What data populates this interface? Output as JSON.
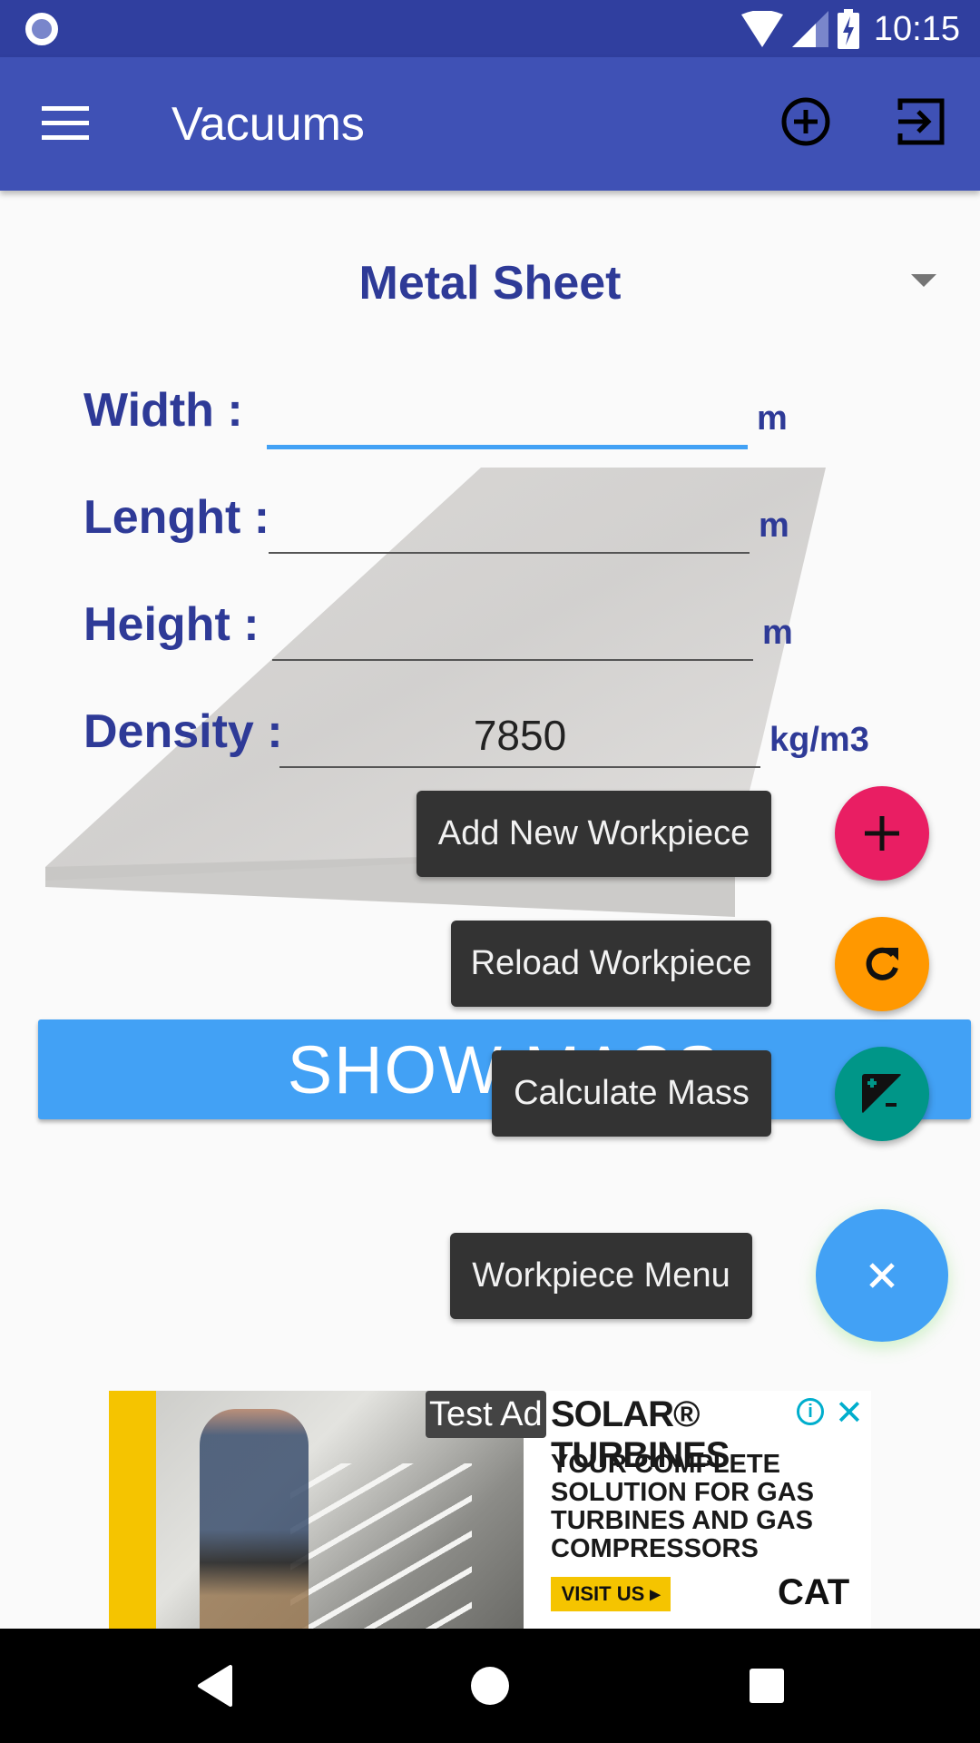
{
  "status_bar": {
    "time": "10:15",
    "icons": [
      "notification-dot-icon",
      "wifi-icon",
      "cell-signal-icon",
      "battery-charging-icon"
    ]
  },
  "app_bar": {
    "title": "Vacuums",
    "menu_icon": "hamburger-menu-icon",
    "actions": [
      {
        "name": "add-circle-icon"
      },
      {
        "name": "exit-to-app-icon"
      }
    ]
  },
  "workpiece_selector": {
    "selected": "Metal Sheet",
    "icon": "dropdown-arrow-icon"
  },
  "form": {
    "fields": [
      {
        "label": "Width :",
        "value": "",
        "unit": "m",
        "focused": true
      },
      {
        "label": "Lenght :",
        "value": "",
        "unit": "m",
        "focused": false
      },
      {
        "label": "Height :",
        "value": "",
        "unit": "m",
        "focused": false
      },
      {
        "label": "Density :",
        "value": "7850",
        "unit": "kg/m3",
        "focused": false
      }
    ]
  },
  "show_mass_button": {
    "label": "SHOW MASS"
  },
  "fab_menu": {
    "items": [
      {
        "label": "Add New Workpiece",
        "icon": "plus-icon",
        "color": "#e91e63"
      },
      {
        "label": "Reload Workpiece",
        "icon": "refresh-icon",
        "color": "#ff9800"
      },
      {
        "label": "Calculate Mass",
        "icon": "exposure-plus-minus-icon",
        "color": "#009688"
      }
    ],
    "main": {
      "label": "Workpiece Menu",
      "icon": "close-icon",
      "color": "#42a1f5"
    }
  },
  "ad": {
    "badge": "Test Ad",
    "headline": "SOLAR® TURBINES",
    "body": "YOUR COMPLETE\nSOLUTION FOR GAS\nTURBINES AND GAS\nCOMPRESSORS",
    "cta": "VISIT US ▸",
    "logo": "CAT",
    "info_icon": "i",
    "close_icon": "✕"
  },
  "nav_bar": {
    "buttons": [
      "back-icon",
      "home-icon",
      "recents-icon"
    ]
  }
}
